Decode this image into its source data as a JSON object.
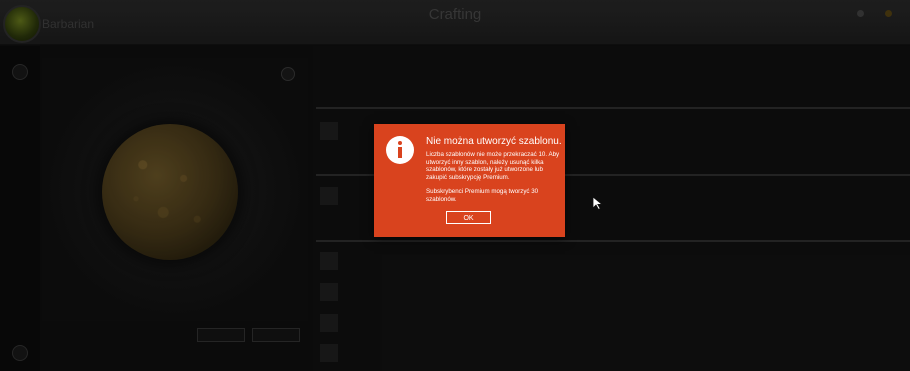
{
  "header": {
    "title": "Crafting",
    "player_level": "",
    "player_name": "Barbarian",
    "player_sub": "",
    "currency_a": "",
    "currency_b": ""
  },
  "preview": {
    "caption": "",
    "button_left": "",
    "button_right": ""
  },
  "list_panel": {
    "title": "",
    "subtitle": "",
    "sections": [
      {
        "title": ""
      },
      {
        "title": ""
      },
      {
        "title": ""
      }
    ],
    "rows": [
      {
        "title": "",
        "sub": ""
      },
      {
        "title": "",
        "sub": ""
      },
      {
        "title": "",
        "sub": ""
      },
      {
        "title": "",
        "sub": ""
      },
      {
        "title": "",
        "sub": ""
      },
      {
        "title": "",
        "sub": ""
      }
    ]
  },
  "modal": {
    "title": "Nie można utworzyć szablonu.",
    "body_1": "Liczba szablonów nie może przekraczać 10. Aby utworzyć inny szablon, należy usunąć kilka szablonów, które zostały już utworzone lub zakupić subskrypcję Premium.",
    "body_2": "Subskrybenci Premium mogą tworzyć 30 szablonów.",
    "ok_label": "OK",
    "icon": "info-icon"
  },
  "colors": {
    "modal_bg": "#d9431e",
    "modal_text": "#ffffff",
    "background": "#0d0d0d"
  }
}
